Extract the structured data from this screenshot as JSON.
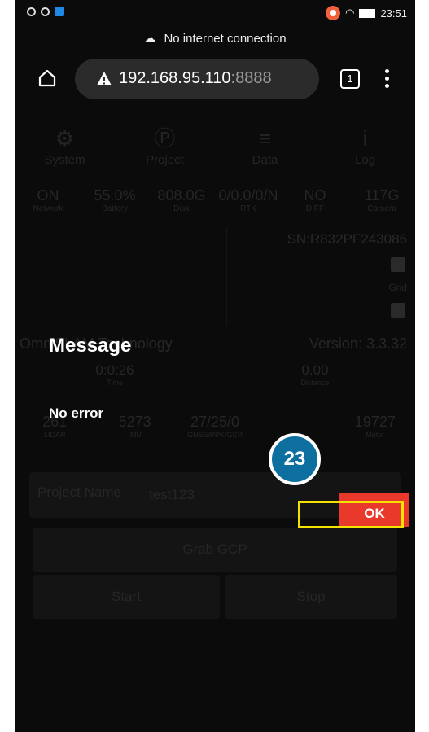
{
  "statusbar": {
    "time": "23:51"
  },
  "banner": {
    "text": "No internet connection"
  },
  "browser": {
    "host": "192.168.95.110",
    "port": ":8888",
    "tab_count": "1"
  },
  "nav": [
    {
      "label": "System",
      "icon": "gears-icon"
    },
    {
      "label": "Project",
      "icon": "project-p-icon"
    },
    {
      "label": "Data",
      "icon": "database-icon"
    },
    {
      "label": "Log",
      "icon": "info-icon"
    }
  ],
  "stats": [
    {
      "value": "ON",
      "label": "Network"
    },
    {
      "value": "55.0%",
      "label": "Battery"
    },
    {
      "value": "808.0G",
      "label": "Disk"
    },
    {
      "value": "0/0.0/0/N",
      "label": "RTK"
    },
    {
      "value": "NO",
      "label": "DIFF"
    },
    {
      "value": "117G",
      "label": "Camera"
    }
  ],
  "serial": "SN:R832PF243086",
  "grid_label": "Grid",
  "brand": "OmniSLAM Technology",
  "version": "Version: 3.3.32",
  "time_row": {
    "time_value": "0:0:26",
    "time_label": "Time",
    "dist_value": "0.00",
    "dist_label": "Distance"
  },
  "counters": [
    {
      "value": "261",
      "label": "LIDAR"
    },
    {
      "value": "5273",
      "label": "IMU"
    },
    {
      "value": "27/25/0",
      "label": "GNSS/PPK/GCP"
    },
    {
      "value": "",
      "label": ""
    },
    {
      "value": "19727",
      "label": "Motor"
    }
  ],
  "project": {
    "label": "Project Name",
    "value": "test123"
  },
  "buttons": {
    "grab_gcp": "Grab GCP",
    "start": "Start",
    "stop": "Stop"
  },
  "dialog": {
    "title": "Message",
    "message": "No error",
    "ok_label": "OK"
  },
  "annotation": {
    "step_number": "23",
    "highlight_color": "#f5e200",
    "badge_color": "#0d6fa0"
  },
  "colors": {
    "ok_button": "#e8392a"
  }
}
